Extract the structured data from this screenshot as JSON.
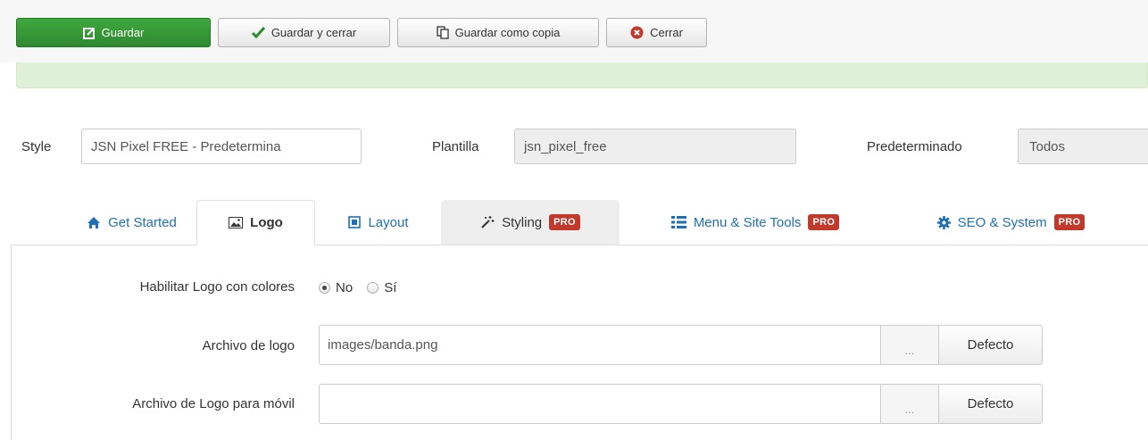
{
  "toolbar": {
    "save_label": "Guardar",
    "save_close_label": "Guardar y cerrar",
    "save_copy_label": "Guardar como copia",
    "close_label": "Cerrar"
  },
  "form_header": {
    "style_label": "Style",
    "style_value": "JSN Pixel FREE - Predetermina",
    "template_label": "Plantilla",
    "template_value": "jsn_pixel_free",
    "default_label": "Predeterminado",
    "default_value": "Todos"
  },
  "tabs": [
    {
      "label": "Get Started",
      "icon": "home-icon"
    },
    {
      "label": "Logo",
      "icon": "image-icon",
      "active": true
    },
    {
      "label": "Layout",
      "icon": "layout-icon"
    },
    {
      "label": "Styling",
      "icon": "magic-wand-icon",
      "badge": "PRO"
    },
    {
      "label": "Menu & Site Tools",
      "icon": "list-icon",
      "badge": "PRO"
    },
    {
      "label": "SEO & System",
      "icon": "gear-icon",
      "badge": "PRO"
    }
  ],
  "logo_settings": {
    "color_logo_label": "Habilitar Logo con colores",
    "option_no": "No",
    "option_yes": "Sí",
    "selected": "No",
    "logo_file_label": "Archivo de logo",
    "logo_file_value": "images/banda.png",
    "mobile_logo_label": "Archivo de Logo para móvil",
    "mobile_logo_value": "",
    "browse_label": "...",
    "default_button_label": "Defecto"
  },
  "colors": {
    "save_green": "#2f8a2f",
    "message_green": "#dff0d8",
    "link_blue": "#1f6fb5",
    "pro_badge_red": "#c0392b"
  }
}
